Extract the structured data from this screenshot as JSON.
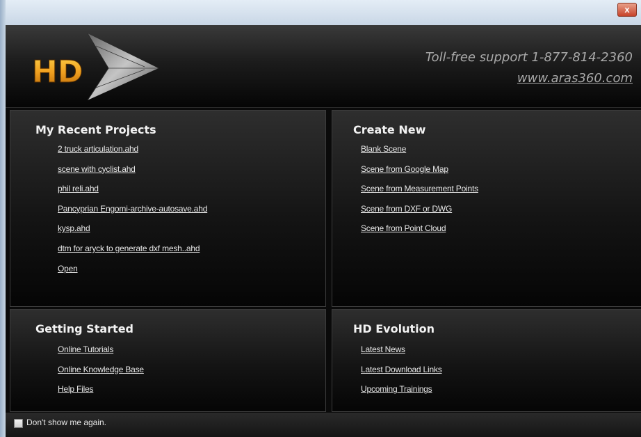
{
  "window": {
    "close_glyph": "x"
  },
  "header": {
    "logo_text": "HD",
    "support_line": "Toll-free support 1-877-814-2360",
    "website": "www.aras360.com"
  },
  "recent_projects": {
    "title": "My Recent Projects",
    "items": [
      "2 truck articulation.ahd",
      "scene with cyclist.ahd",
      "phil reli.ahd",
      "Pancyprian Engomi-archive-autosave.ahd",
      "kysp.ahd",
      "dtm for aryck to generate dxf mesh..ahd",
      "Open"
    ]
  },
  "create_new": {
    "title": "Create New",
    "items": [
      "Blank Scene",
      "Scene from Google Map",
      "Scene from Measurement Points",
      "Scene from DXF or DWG",
      "Scene from Point Cloud"
    ]
  },
  "getting_started": {
    "title": "Getting Started",
    "items": [
      "Online Tutorials",
      "Online Knowledge Base",
      "Help Files"
    ]
  },
  "hd_evolution": {
    "title": "HD Evolution",
    "items": [
      "Latest News",
      "Latest Download Links",
      "Upcoming Trainings"
    ]
  },
  "footer": {
    "checkbox_label": "Don't show me again.",
    "checked": false
  },
  "colors": {
    "accent_logo": "#f0a020",
    "panel_text": "#e8e8e8",
    "support_text": "#a9a9a9"
  }
}
